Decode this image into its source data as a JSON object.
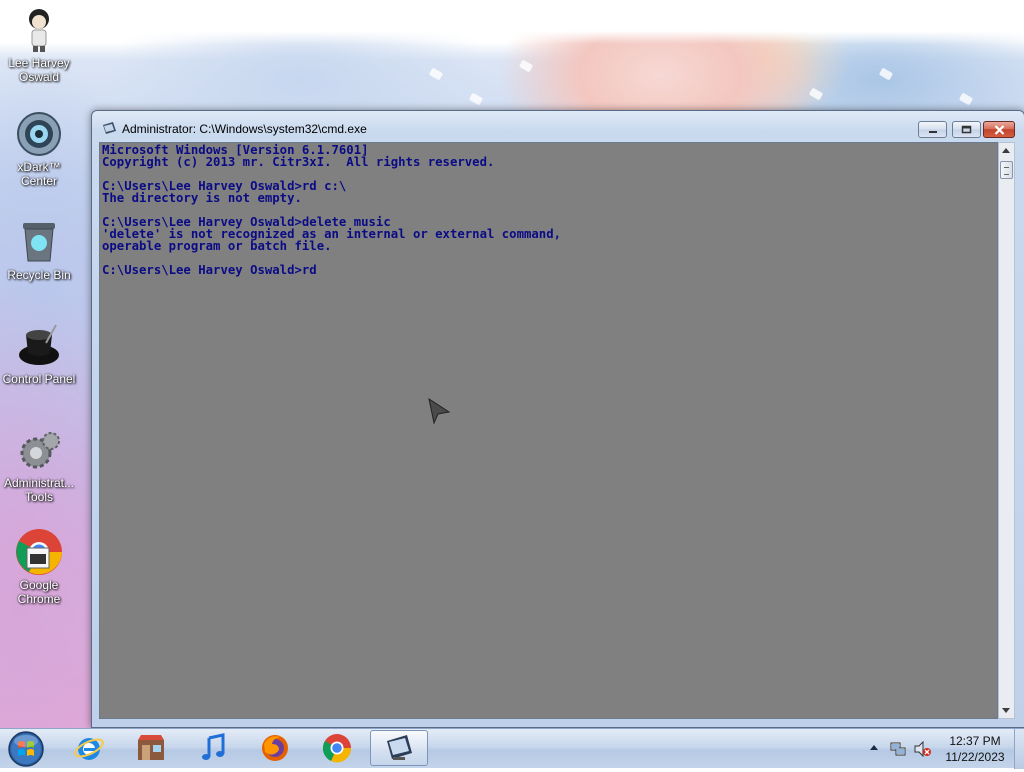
{
  "desktop": {
    "icons": [
      {
        "label": "Lee Harvey Oswald",
        "icon": "user-figure-icon"
      },
      {
        "label": "xDark™ Center",
        "icon": "xdark-center-icon"
      },
      {
        "label": "Recycle Bin",
        "icon": "recycle-bin-icon"
      },
      {
        "label": "Control Panel",
        "icon": "control-panel-icon"
      },
      {
        "label": "Administrat... Tools",
        "icon": "admin-tools-icon"
      },
      {
        "label": "Google Chrome",
        "icon": "chrome-icon"
      }
    ]
  },
  "window": {
    "title": "Administrator: C:\\Windows\\system32\\cmd.exe",
    "buttons": {
      "minimize": "minimize-icon",
      "maximize": "maximize-icon",
      "close": "close-icon"
    }
  },
  "console": {
    "text_color": "#0b0b86",
    "background": "#808080",
    "lines": [
      "Microsoft Windows [Version 6.1.7601]",
      "Copyright (c) 2013 mr. Citr3xI.  All rights reserved.",
      "",
      "C:\\Users\\Lee Harvey Oswald>rd c:\\",
      "The directory is not empty.",
      "",
      "C:\\Users\\Lee Harvey Oswald>delete music",
      "'delete' is not recognized as an internal or external command,",
      "operable program or batch file.",
      "",
      "C:\\Users\\Lee Harvey Oswald>rd"
    ]
  },
  "taskbar": {
    "items": [
      {
        "name": "internet-explorer",
        "icon": "internet-explorer-icon",
        "active": false
      },
      {
        "name": "store",
        "icon": "store-icon",
        "active": false
      },
      {
        "name": "itunes",
        "icon": "music-note-icon",
        "active": false
      },
      {
        "name": "firefox",
        "icon": "firefox-icon",
        "active": false
      },
      {
        "name": "chrome",
        "icon": "chrome-icon",
        "active": false
      },
      {
        "name": "cmd",
        "icon": "cmd-icon",
        "active": true
      }
    ],
    "clock": {
      "time": "12:37 PM",
      "date": "11/22/2023"
    }
  }
}
